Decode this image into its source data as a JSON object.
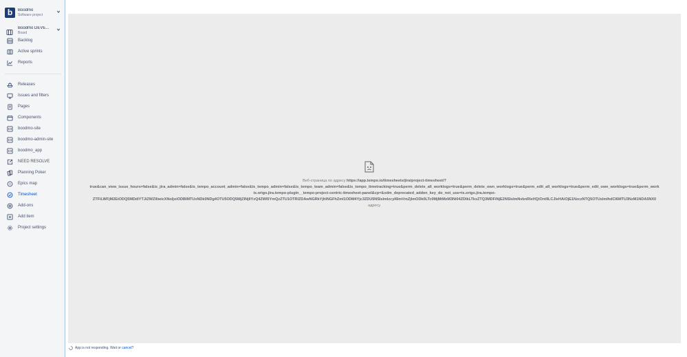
{
  "project": {
    "logo_letter": "b",
    "name": "Boodmo",
    "type": "Software project"
  },
  "board": {
    "name": "Boodmo DEVE...",
    "type": "Board"
  },
  "nav": {
    "backlog": "Backlog",
    "active_sprints": "Active sprints",
    "reports": "Reports",
    "releases": "Releases",
    "issues_filters": "Issues and filters",
    "pages": "Pages",
    "components": "Components",
    "boodmo_site": "boodmo-site",
    "boodmo_admin_site": "boodmo-admin-site",
    "boodmo_app": "boodmo_app",
    "need_resolve": "NEED RESOLVE",
    "planning_poker": "Planning Poker",
    "epics_map": "Epics map",
    "timesheet": "Timesheet",
    "addons": "Add-ons",
    "add_item": "Add item",
    "project_settings": "Project settings"
  },
  "error": {
    "prefix": "Веб-страница по адресу",
    "url_line1": "https://app.tempo.io/timesheets/jira/project-timesheet/?",
    "url_line2": "true&can_view_issue_hours=false&is_jira_admin=false&is_tempo_account_admin=false&is_tempo_admin=false&is_tempo_team_admin=false&is_tempo_timetracking=true&perm_delete_all_worklogs=true&perm_delete_own_worklogs=true&perm_edit_all_worklogs=true&perm_edit_own_worklogs=true&perm_work",
    "url_line3": "is.origo.jira.tempo-plugin__tempo-project-centric-timesheet-panel&cp=&xdm_deprecated_addon_key_do_not_use=is.origo.jira.tempo-",
    "url_line4": "ZTFiLWFjM2EtODQ5MDdlYTJiZWZlIiwicXNoIjoiODBlMTUxNDk0NDg4OTU5ODQ5MjZlNjllYzQ4ZWI5YmQzZTU1OTRlZDAwNGRkYjhlNGFhZmI1ODM4Yjc3ZDU5NSIsImlzcyI6ImVmZjlmODk0LTc0MjMtMzM3Ni04ZDlkLTkxZTQ3MDFiNjE2NSIsImNvbnRleHQiOnt9LCJleHAiOjE1NzczNTQ5OTUsImlhdCI6MTU3NzM1NDA5NX0",
    "suffix": "адресу."
  },
  "status": {
    "text": "App is not responding. Wait or ",
    "link": "cancel",
    "end": "?"
  }
}
